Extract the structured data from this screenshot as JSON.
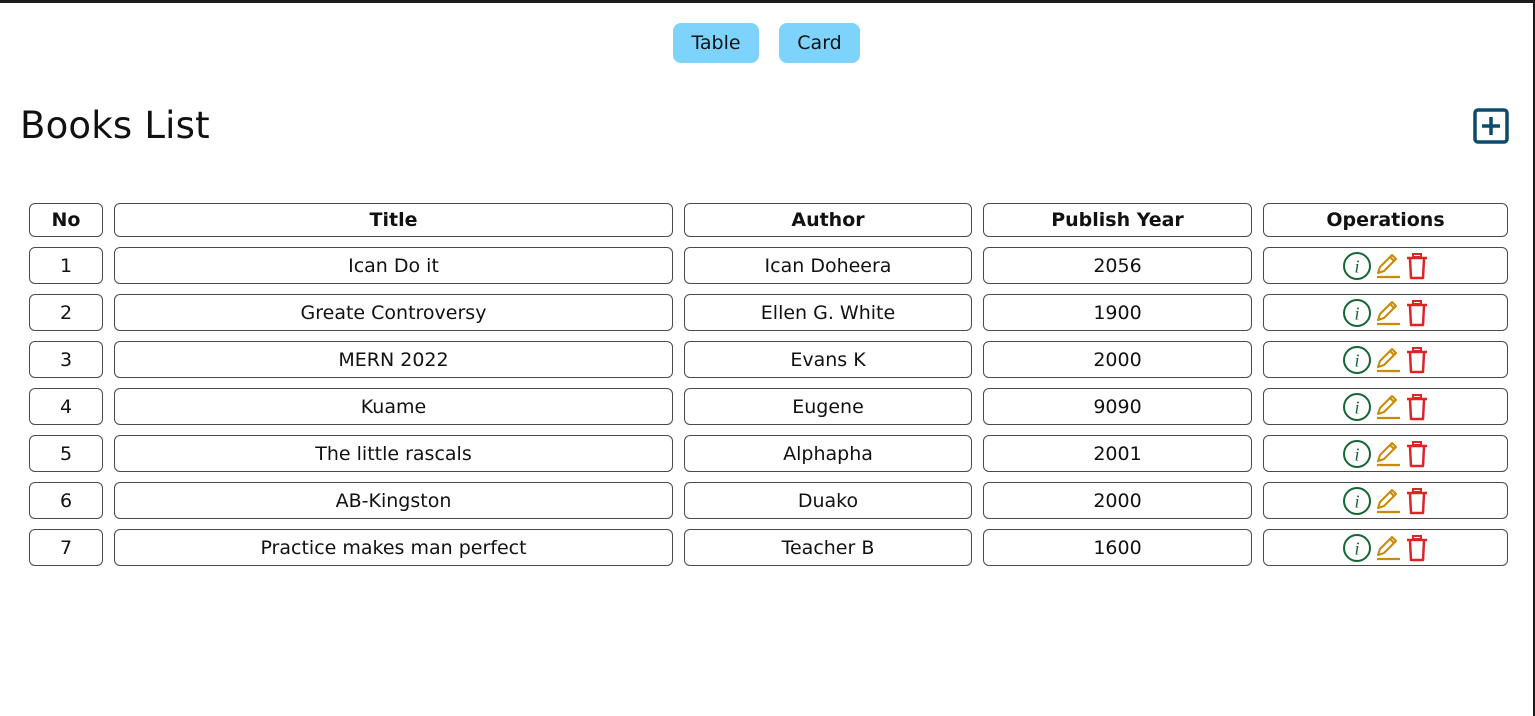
{
  "view_toggle": {
    "table_label": "Table",
    "card_label": "Card"
  },
  "page_title": "Books List",
  "icons": {
    "add": "plus-square-icon",
    "info": "info-circle-icon",
    "edit": "pencil-icon",
    "delete": "trash-icon"
  },
  "colors": {
    "toggle_bg": "#7dd3fc",
    "add": "#0c4a6e",
    "info": "#166534",
    "edit": "#ca8a04",
    "delete": "#dc2626"
  },
  "table": {
    "headers": {
      "no": "No",
      "title": "Title",
      "author": "Author",
      "year": "Publish Year",
      "operations": "Operations"
    },
    "rows": [
      {
        "no": "1",
        "title": "Ican Do it",
        "author": "Ican Doheera",
        "year": "2056"
      },
      {
        "no": "2",
        "title": "Greate Controversy",
        "author": "Ellen G. White",
        "year": "1900"
      },
      {
        "no": "3",
        "title": "MERN 2022",
        "author": "Evans K",
        "year": "2000"
      },
      {
        "no": "4",
        "title": "Kuame",
        "author": "Eugene",
        "year": "9090"
      },
      {
        "no": "5",
        "title": "The little rascals",
        "author": "Alphapha",
        "year": "2001"
      },
      {
        "no": "6",
        "title": "AB-Kingston",
        "author": "Duako",
        "year": "2000"
      },
      {
        "no": "7",
        "title": "Practice makes man perfect",
        "author": "Teacher B",
        "year": "1600"
      }
    ]
  }
}
